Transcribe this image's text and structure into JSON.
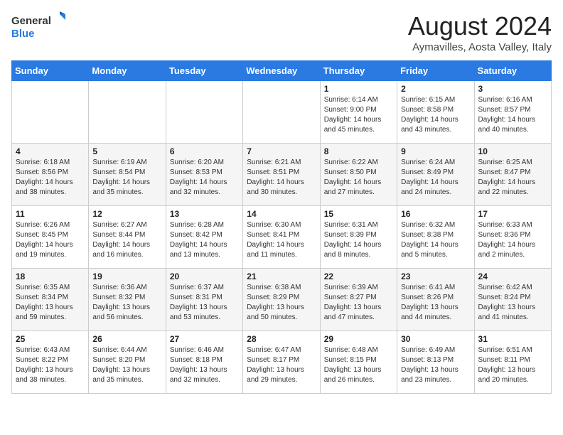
{
  "logo": {
    "general": "General",
    "blue": "Blue"
  },
  "title": "August 2024",
  "location": "Aymavilles, Aosta Valley, Italy",
  "headers": [
    "Sunday",
    "Monday",
    "Tuesday",
    "Wednesday",
    "Thursday",
    "Friday",
    "Saturday"
  ],
  "weeks": [
    [
      {
        "day": "",
        "info": ""
      },
      {
        "day": "",
        "info": ""
      },
      {
        "day": "",
        "info": ""
      },
      {
        "day": "",
        "info": ""
      },
      {
        "day": "1",
        "info": "Sunrise: 6:14 AM\nSunset: 9:00 PM\nDaylight: 14 hours and 45 minutes."
      },
      {
        "day": "2",
        "info": "Sunrise: 6:15 AM\nSunset: 8:58 PM\nDaylight: 14 hours and 43 minutes."
      },
      {
        "day": "3",
        "info": "Sunrise: 6:16 AM\nSunset: 8:57 PM\nDaylight: 14 hours and 40 minutes."
      }
    ],
    [
      {
        "day": "4",
        "info": "Sunrise: 6:18 AM\nSunset: 8:56 PM\nDaylight: 14 hours and 38 minutes."
      },
      {
        "day": "5",
        "info": "Sunrise: 6:19 AM\nSunset: 8:54 PM\nDaylight: 14 hours and 35 minutes."
      },
      {
        "day": "6",
        "info": "Sunrise: 6:20 AM\nSunset: 8:53 PM\nDaylight: 14 hours and 32 minutes."
      },
      {
        "day": "7",
        "info": "Sunrise: 6:21 AM\nSunset: 8:51 PM\nDaylight: 14 hours and 30 minutes."
      },
      {
        "day": "8",
        "info": "Sunrise: 6:22 AM\nSunset: 8:50 PM\nDaylight: 14 hours and 27 minutes."
      },
      {
        "day": "9",
        "info": "Sunrise: 6:24 AM\nSunset: 8:49 PM\nDaylight: 14 hours and 24 minutes."
      },
      {
        "day": "10",
        "info": "Sunrise: 6:25 AM\nSunset: 8:47 PM\nDaylight: 14 hours and 22 minutes."
      }
    ],
    [
      {
        "day": "11",
        "info": "Sunrise: 6:26 AM\nSunset: 8:45 PM\nDaylight: 14 hours and 19 minutes."
      },
      {
        "day": "12",
        "info": "Sunrise: 6:27 AM\nSunset: 8:44 PM\nDaylight: 14 hours and 16 minutes."
      },
      {
        "day": "13",
        "info": "Sunrise: 6:28 AM\nSunset: 8:42 PM\nDaylight: 14 hours and 13 minutes."
      },
      {
        "day": "14",
        "info": "Sunrise: 6:30 AM\nSunset: 8:41 PM\nDaylight: 14 hours and 11 minutes."
      },
      {
        "day": "15",
        "info": "Sunrise: 6:31 AM\nSunset: 8:39 PM\nDaylight: 14 hours and 8 minutes."
      },
      {
        "day": "16",
        "info": "Sunrise: 6:32 AM\nSunset: 8:38 PM\nDaylight: 14 hours and 5 minutes."
      },
      {
        "day": "17",
        "info": "Sunrise: 6:33 AM\nSunset: 8:36 PM\nDaylight: 14 hours and 2 minutes."
      }
    ],
    [
      {
        "day": "18",
        "info": "Sunrise: 6:35 AM\nSunset: 8:34 PM\nDaylight: 13 hours and 59 minutes."
      },
      {
        "day": "19",
        "info": "Sunrise: 6:36 AM\nSunset: 8:32 PM\nDaylight: 13 hours and 56 minutes."
      },
      {
        "day": "20",
        "info": "Sunrise: 6:37 AM\nSunset: 8:31 PM\nDaylight: 13 hours and 53 minutes."
      },
      {
        "day": "21",
        "info": "Sunrise: 6:38 AM\nSunset: 8:29 PM\nDaylight: 13 hours and 50 minutes."
      },
      {
        "day": "22",
        "info": "Sunrise: 6:39 AM\nSunset: 8:27 PM\nDaylight: 13 hours and 47 minutes."
      },
      {
        "day": "23",
        "info": "Sunrise: 6:41 AM\nSunset: 8:26 PM\nDaylight: 13 hours and 44 minutes."
      },
      {
        "day": "24",
        "info": "Sunrise: 6:42 AM\nSunset: 8:24 PM\nDaylight: 13 hours and 41 minutes."
      }
    ],
    [
      {
        "day": "25",
        "info": "Sunrise: 6:43 AM\nSunset: 8:22 PM\nDaylight: 13 hours and 38 minutes."
      },
      {
        "day": "26",
        "info": "Sunrise: 6:44 AM\nSunset: 8:20 PM\nDaylight: 13 hours and 35 minutes."
      },
      {
        "day": "27",
        "info": "Sunrise: 6:46 AM\nSunset: 8:18 PM\nDaylight: 13 hours and 32 minutes."
      },
      {
        "day": "28",
        "info": "Sunrise: 6:47 AM\nSunset: 8:17 PM\nDaylight: 13 hours and 29 minutes."
      },
      {
        "day": "29",
        "info": "Sunrise: 6:48 AM\nSunset: 8:15 PM\nDaylight: 13 hours and 26 minutes."
      },
      {
        "day": "30",
        "info": "Sunrise: 6:49 AM\nSunset: 8:13 PM\nDaylight: 13 hours and 23 minutes."
      },
      {
        "day": "31",
        "info": "Sunrise: 6:51 AM\nSunset: 8:11 PM\nDaylight: 13 hours and 20 minutes."
      }
    ]
  ]
}
